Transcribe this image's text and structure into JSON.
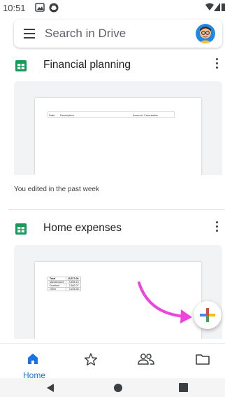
{
  "status_bar": {
    "time": "10:51"
  },
  "search": {
    "placeholder": "Search in Drive"
  },
  "files": [
    {
      "title": "Financial planning",
      "columns": [
        "Date",
        "Description",
        "Amount",
        "Cumulative"
      ],
      "caption": "You edited in the past week"
    },
    {
      "title": "Home expenses",
      "rows": [
        {
          "label": "Total",
          "value": "15,573.06"
        },
        {
          "label": "Maintenance",
          "value": "3,895.15"
        },
        {
          "label": "Furniture",
          "value": "2,682.07"
        },
        {
          "label": "Other",
          "value": "3,246.35"
        }
      ]
    }
  ],
  "bottom_nav": {
    "home_label": "Home",
    "items": [
      "home-icon",
      "star-icon",
      "shared-icon",
      "folder-icon"
    ]
  },
  "colors": {
    "accent": "#1a73e8",
    "sheets_green": "#0f9d58",
    "arrow_magenta": "#ee44dd",
    "fab_red": "#ea4335",
    "fab_yellow": "#fbbc04",
    "fab_green": "#34a853",
    "fab_blue": "#4285f4"
  }
}
